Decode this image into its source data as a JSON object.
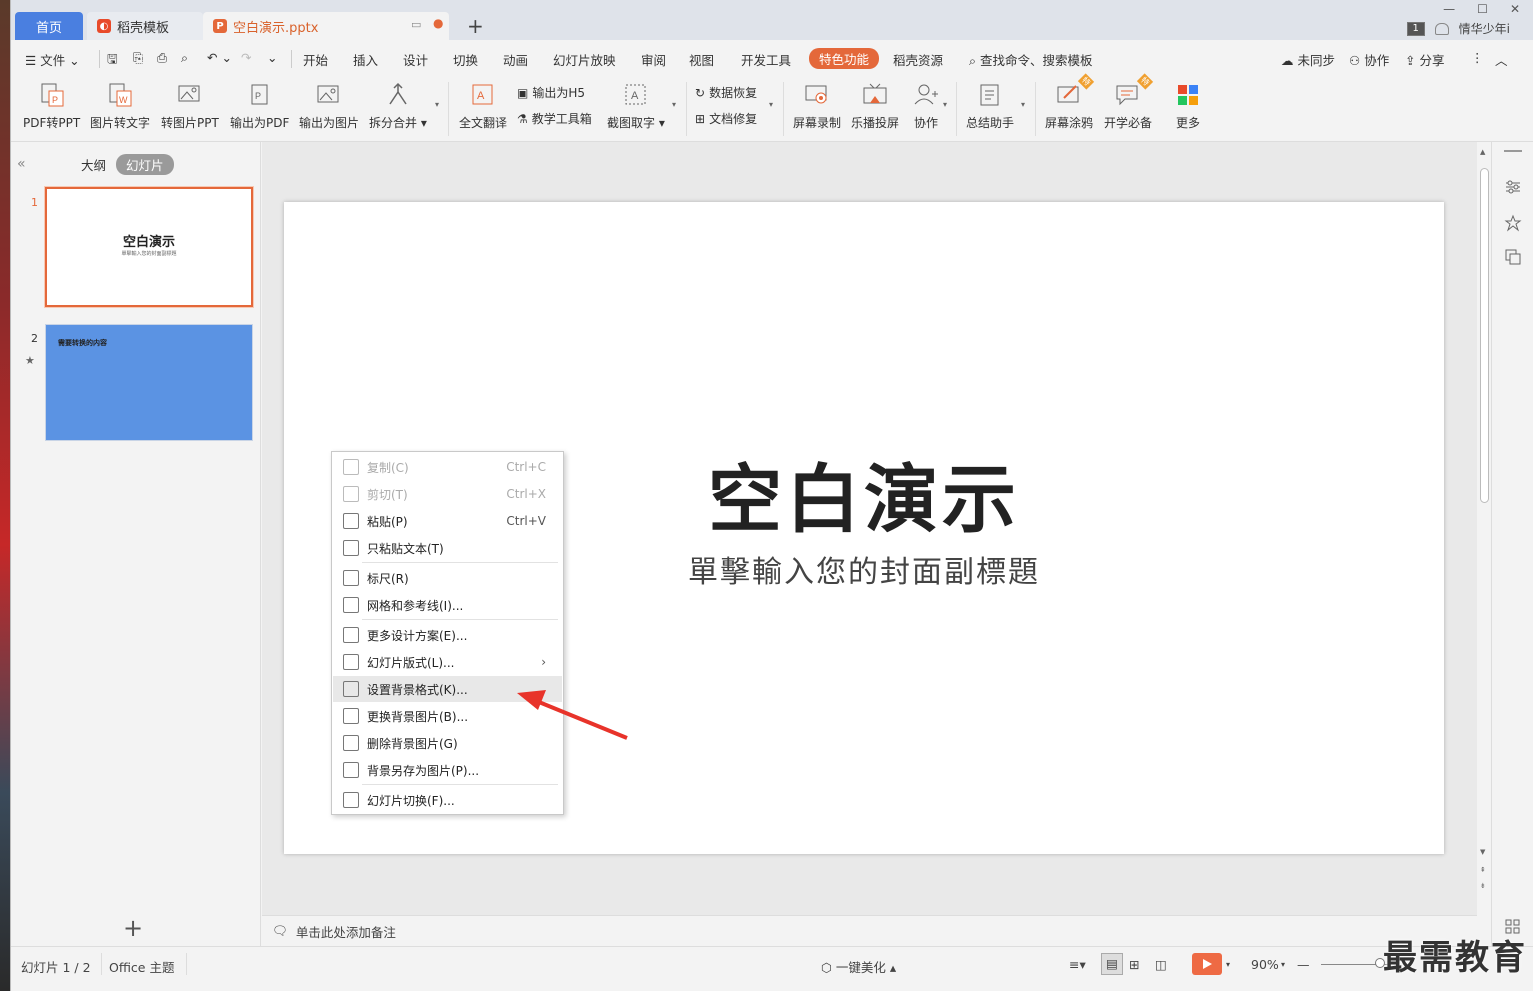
{
  "tabs": {
    "home": "首页",
    "template": "稻壳模板",
    "document": "空白演示.pptx"
  },
  "user": {
    "badge": "1",
    "name": "情华少年i"
  },
  "menu": {
    "file": "文件",
    "items": [
      "开始",
      "插入",
      "设计",
      "切换",
      "动画",
      "幻灯片放映",
      "审阅",
      "视图",
      "开发工具",
      "特色功能",
      "稻壳资源"
    ],
    "active": "特色功能",
    "search": "查找命令、搜索模板",
    "sync": "未同步",
    "collab": "协作",
    "share": "分享"
  },
  "ribbon": {
    "pdf_to_ppt": "PDF转PPT",
    "img_to_text": "图片转文字",
    "to_img_ppt": "转图片PPT",
    "export_pdf": "输出为PDF",
    "export_img": "输出为图片",
    "split_merge": "拆分合并",
    "translate": "全文翻译",
    "export_h5": "输出为H5",
    "teach_tools": "教学工具箱",
    "screenshot_ocr": "截图取字",
    "data_recover": "数据恢复",
    "doc_repair": "文档修复",
    "screen_record": "屏幕录制",
    "cast": "乐播投屏",
    "collab": "协作",
    "summary": "总结助手",
    "screen_draw": "屏幕涂鸦",
    "school": "开学必备",
    "more": "更多",
    "badge": "特"
  },
  "panel": {
    "outline": "大纲",
    "slides": "幻灯片",
    "slide1_num": "1",
    "slide1_title": "空白演示",
    "slide1_sub": "單擊輸入您的封面副標題",
    "slide2_num": "2",
    "slide2_text": "需要转换的内容",
    "slide2_star": "★",
    "add": "+"
  },
  "slide": {
    "title": "空白演示",
    "subtitle": "單擊輸入您的封面副標題"
  },
  "context_menu": [
    {
      "label": "复制(C)",
      "shortcut": "Ctrl+C",
      "disabled": true
    },
    {
      "label": "剪切(T)",
      "shortcut": "Ctrl+X",
      "disabled": true
    },
    {
      "label": "粘贴(P)",
      "shortcut": "Ctrl+V",
      "disabled": false
    },
    {
      "label": "只粘贴文本(T)",
      "shortcut": "",
      "disabled": false
    },
    {
      "label": "标尺(R)",
      "shortcut": "",
      "disabled": false
    },
    {
      "label": "网格和参考线(I)...",
      "shortcut": "",
      "disabled": false
    },
    {
      "label": "更多设计方案(E)...",
      "shortcut": "",
      "disabled": false
    },
    {
      "label": "幻灯片版式(L)...",
      "shortcut": "›",
      "disabled": false
    },
    {
      "label": "设置背景格式(K)...",
      "shortcut": "",
      "disabled": false,
      "highlighted": true
    },
    {
      "label": "更换背景图片(B)...",
      "shortcut": "",
      "disabled": false
    },
    {
      "label": "删除背景图片(G)",
      "shortcut": "",
      "disabled": false
    },
    {
      "label": "背景另存为图片(P)...",
      "shortcut": "",
      "disabled": false
    },
    {
      "label": "幻灯片切换(F)...",
      "shortcut": "",
      "disabled": false
    }
  ],
  "notes": {
    "placeholder": "单击此处添加备注"
  },
  "status": {
    "slide_count": "幻灯片 1 / 2",
    "theme": "Office 主题",
    "beautify": "一键美化",
    "zoom": "90%"
  },
  "watermark": "最需教育",
  "colors": {
    "accent": "#e4683a",
    "home_tab": "#4a7fe0",
    "slide2_bg": "#5b93e3",
    "arrow": "#e8332a"
  }
}
